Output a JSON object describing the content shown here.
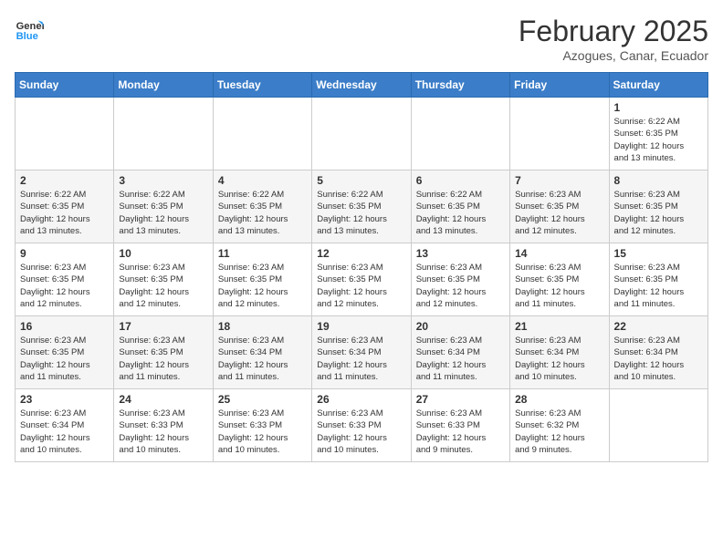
{
  "header": {
    "logo_general": "General",
    "logo_blue": "Blue",
    "month_title": "February 2025",
    "location": "Azogues, Canar, Ecuador"
  },
  "weekdays": [
    "Sunday",
    "Monday",
    "Tuesday",
    "Wednesday",
    "Thursday",
    "Friday",
    "Saturday"
  ],
  "weeks": [
    [
      {
        "day": "",
        "info": ""
      },
      {
        "day": "",
        "info": ""
      },
      {
        "day": "",
        "info": ""
      },
      {
        "day": "",
        "info": ""
      },
      {
        "day": "",
        "info": ""
      },
      {
        "day": "",
        "info": ""
      },
      {
        "day": "1",
        "info": "Sunrise: 6:22 AM\nSunset: 6:35 PM\nDaylight: 12 hours\nand 13 minutes."
      }
    ],
    [
      {
        "day": "2",
        "info": "Sunrise: 6:22 AM\nSunset: 6:35 PM\nDaylight: 12 hours\nand 13 minutes."
      },
      {
        "day": "3",
        "info": "Sunrise: 6:22 AM\nSunset: 6:35 PM\nDaylight: 12 hours\nand 13 minutes."
      },
      {
        "day": "4",
        "info": "Sunrise: 6:22 AM\nSunset: 6:35 PM\nDaylight: 12 hours\nand 13 minutes."
      },
      {
        "day": "5",
        "info": "Sunrise: 6:22 AM\nSunset: 6:35 PM\nDaylight: 12 hours\nand 13 minutes."
      },
      {
        "day": "6",
        "info": "Sunrise: 6:22 AM\nSunset: 6:35 PM\nDaylight: 12 hours\nand 13 minutes."
      },
      {
        "day": "7",
        "info": "Sunrise: 6:23 AM\nSunset: 6:35 PM\nDaylight: 12 hours\nand 12 minutes."
      },
      {
        "day": "8",
        "info": "Sunrise: 6:23 AM\nSunset: 6:35 PM\nDaylight: 12 hours\nand 12 minutes."
      }
    ],
    [
      {
        "day": "9",
        "info": "Sunrise: 6:23 AM\nSunset: 6:35 PM\nDaylight: 12 hours\nand 12 minutes."
      },
      {
        "day": "10",
        "info": "Sunrise: 6:23 AM\nSunset: 6:35 PM\nDaylight: 12 hours\nand 12 minutes."
      },
      {
        "day": "11",
        "info": "Sunrise: 6:23 AM\nSunset: 6:35 PM\nDaylight: 12 hours\nand 12 minutes."
      },
      {
        "day": "12",
        "info": "Sunrise: 6:23 AM\nSunset: 6:35 PM\nDaylight: 12 hours\nand 12 minutes."
      },
      {
        "day": "13",
        "info": "Sunrise: 6:23 AM\nSunset: 6:35 PM\nDaylight: 12 hours\nand 12 minutes."
      },
      {
        "day": "14",
        "info": "Sunrise: 6:23 AM\nSunset: 6:35 PM\nDaylight: 12 hours\nand 11 minutes."
      },
      {
        "day": "15",
        "info": "Sunrise: 6:23 AM\nSunset: 6:35 PM\nDaylight: 12 hours\nand 11 minutes."
      }
    ],
    [
      {
        "day": "16",
        "info": "Sunrise: 6:23 AM\nSunset: 6:35 PM\nDaylight: 12 hours\nand 11 minutes."
      },
      {
        "day": "17",
        "info": "Sunrise: 6:23 AM\nSunset: 6:35 PM\nDaylight: 12 hours\nand 11 minutes."
      },
      {
        "day": "18",
        "info": "Sunrise: 6:23 AM\nSunset: 6:34 PM\nDaylight: 12 hours\nand 11 minutes."
      },
      {
        "day": "19",
        "info": "Sunrise: 6:23 AM\nSunset: 6:34 PM\nDaylight: 12 hours\nand 11 minutes."
      },
      {
        "day": "20",
        "info": "Sunrise: 6:23 AM\nSunset: 6:34 PM\nDaylight: 12 hours\nand 11 minutes."
      },
      {
        "day": "21",
        "info": "Sunrise: 6:23 AM\nSunset: 6:34 PM\nDaylight: 12 hours\nand 10 minutes."
      },
      {
        "day": "22",
        "info": "Sunrise: 6:23 AM\nSunset: 6:34 PM\nDaylight: 12 hours\nand 10 minutes."
      }
    ],
    [
      {
        "day": "23",
        "info": "Sunrise: 6:23 AM\nSunset: 6:34 PM\nDaylight: 12 hours\nand 10 minutes."
      },
      {
        "day": "24",
        "info": "Sunrise: 6:23 AM\nSunset: 6:33 PM\nDaylight: 12 hours\nand 10 minutes."
      },
      {
        "day": "25",
        "info": "Sunrise: 6:23 AM\nSunset: 6:33 PM\nDaylight: 12 hours\nand 10 minutes."
      },
      {
        "day": "26",
        "info": "Sunrise: 6:23 AM\nSunset: 6:33 PM\nDaylight: 12 hours\nand 10 minutes."
      },
      {
        "day": "27",
        "info": "Sunrise: 6:23 AM\nSunset: 6:33 PM\nDaylight: 12 hours\nand 9 minutes."
      },
      {
        "day": "28",
        "info": "Sunrise: 6:23 AM\nSunset: 6:32 PM\nDaylight: 12 hours\nand 9 minutes."
      },
      {
        "day": "",
        "info": ""
      }
    ]
  ]
}
